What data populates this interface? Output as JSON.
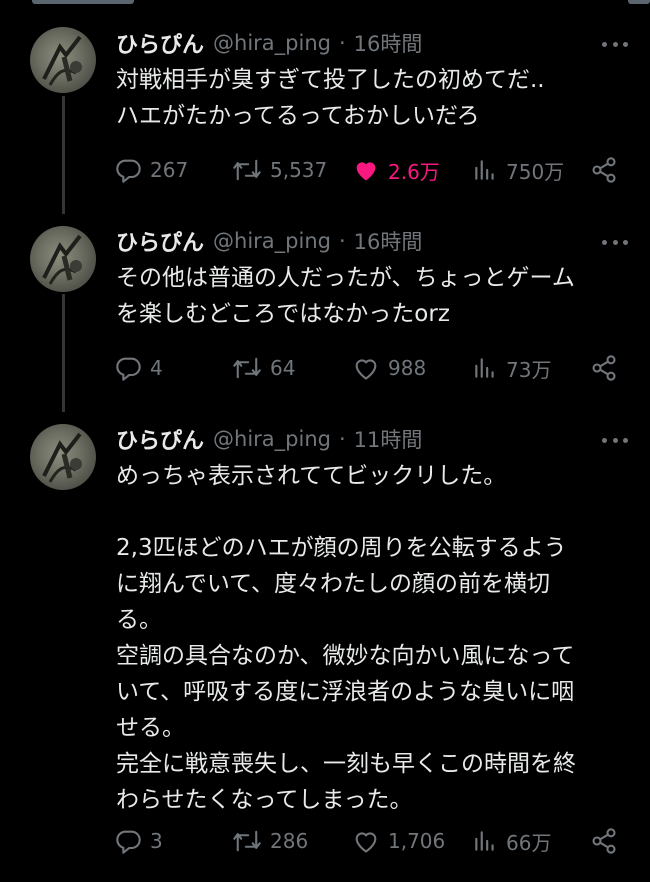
{
  "tweets": [
    {
      "name": "ひらぴん",
      "handle": "@hira_ping",
      "separator": "·",
      "time": "16時間",
      "text": "対戦相手が臭すぎて投了したの初めてだ..\nハエがたかってるっておかしいだろ",
      "replies": "267",
      "retweets": "5,537",
      "likes": "2.6万",
      "views": "750万",
      "liked": true
    },
    {
      "name": "ひらぴん",
      "handle": "@hira_ping",
      "separator": "·",
      "time": "16時間",
      "text": "その他は普通の人だったが、ちょっとゲーム\nを楽しむどころではなかったorz",
      "replies": "4",
      "retweets": "64",
      "likes": "988",
      "views": "73万",
      "liked": false
    },
    {
      "name": "ひらぴん",
      "handle": "@hira_ping",
      "separator": "·",
      "time": "11時間",
      "text": "めっちゃ表示されててビックリした。\n\n2,3匹ほどのハエが顔の周りを公転するよう\nに翔んでいて、度々わたしの顔の前を横切\nる。\n空調の具合なのか、微妙な向かい風になって\nいて、呼吸する度に浮浪者のような臭いに咽\nせる。\n完全に戦意喪失し、一刻も早くこの時間を終\nわらせたくなってしまった。",
      "replies": "3",
      "retweets": "286",
      "likes": "1,706",
      "views": "66万",
      "liked": false
    }
  ],
  "icons": {
    "reply": "reply-icon",
    "retweet": "retweet-icon",
    "like": "heart-icon",
    "views": "views-icon",
    "share": "share-icon",
    "more": "more-icon"
  },
  "colors": {
    "background": "#000000",
    "text": "#e7e9ea",
    "muted": "#71767b",
    "like_active": "#f91880",
    "thread_line": "#333639"
  }
}
